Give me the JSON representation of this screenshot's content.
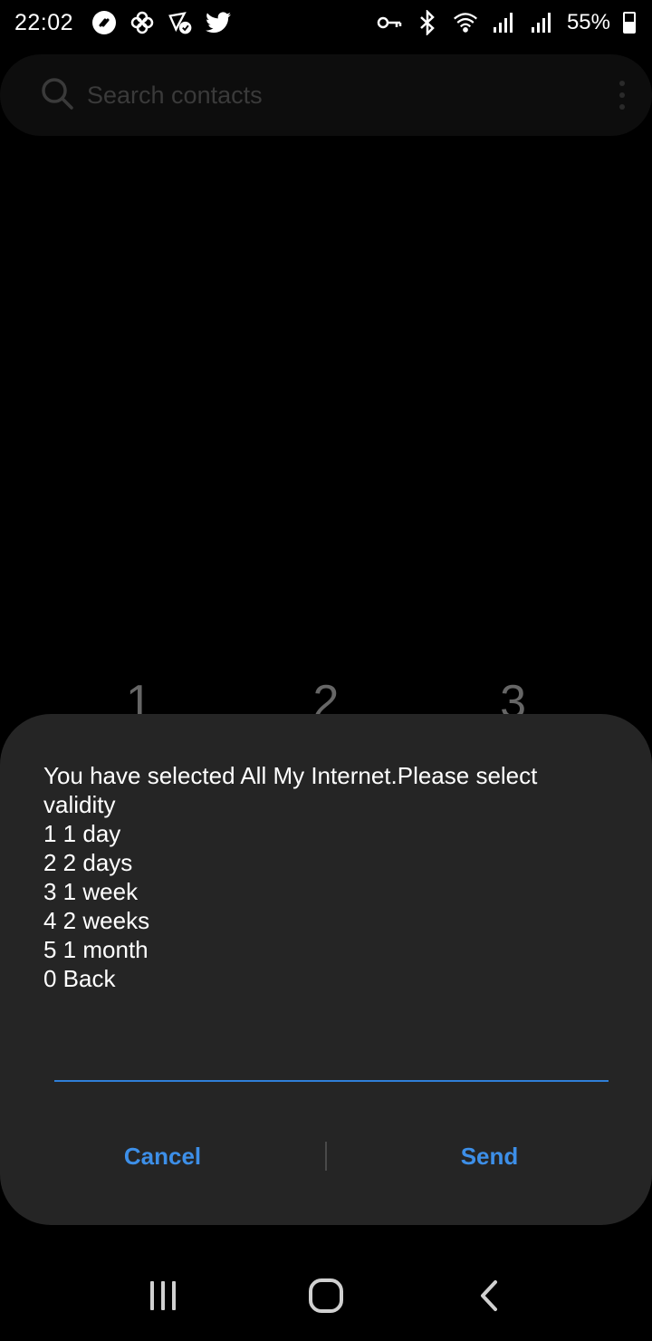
{
  "status_bar": {
    "time": "22:02",
    "battery_percent": "55%",
    "battery_level": 0.55,
    "icons_left": [
      "shazam-icon",
      "pinwheel-icon",
      "network-check-icon",
      "twitter-icon"
    ],
    "icons_right": [
      "vpn-key-icon",
      "bluetooth-icon",
      "wifi-icon",
      "signal-icon",
      "signal-icon"
    ]
  },
  "search": {
    "placeholder": "Search contacts"
  },
  "dialpad": {
    "digits": [
      "1",
      "2",
      "3"
    ]
  },
  "dialog": {
    "message": "You have selected All My Internet.Please select validity\n1 1 day\n2 2 days\n3 1 week\n4 2 weeks\n5 1 month\n0 Back",
    "input_value": "",
    "cancel_label": "Cancel",
    "send_label": "Send"
  },
  "colors": {
    "accent": "#3d8fe8",
    "dialog_bg": "#252525",
    "input_underline": "#2f7fd8"
  },
  "nav_bar": {
    "buttons": [
      "recents-icon",
      "home-icon",
      "back-icon"
    ]
  }
}
